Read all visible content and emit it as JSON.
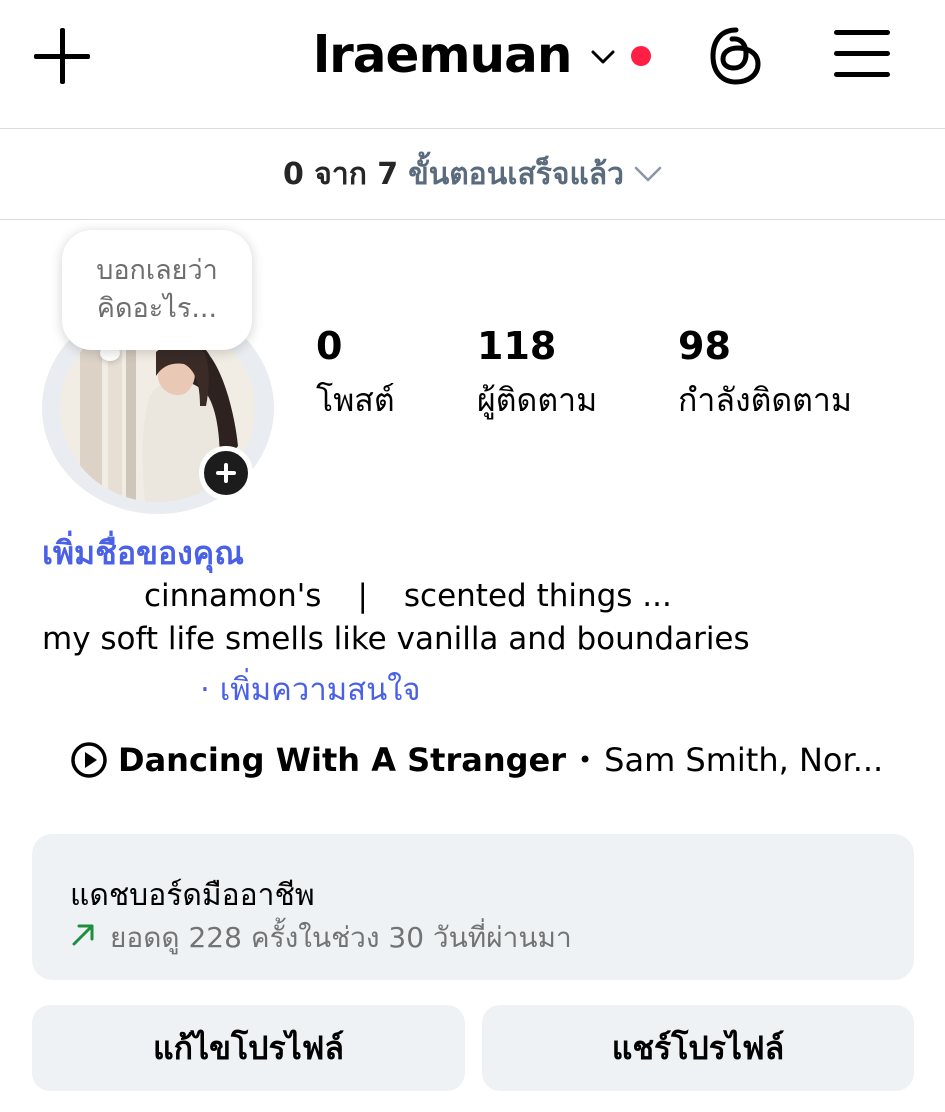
{
  "header": {
    "username": "lraemuan",
    "notification_color": "#ff1f45"
  },
  "steps": {
    "count": "0 จาก 7",
    "label": "ขั้นตอนเสร็จแล้ว"
  },
  "note": {
    "line1": "บอกเลยว่า",
    "line2": "คิดอะไร..."
  },
  "stats": [
    {
      "value": "0",
      "label": "โพสต์"
    },
    {
      "value": "118",
      "label": "ผู้ติดตาม"
    },
    {
      "value": "98",
      "label": "กำลังติดตาม"
    }
  ],
  "profile": {
    "add_name": "เพิ่มชื่อของคุณ",
    "bio_left": "cinnamon's",
    "bio_sep": "|",
    "bio_right": "scented things ...",
    "bio_line2": "my soft life smells like vanilla and boundaries",
    "add_interest": "· เพิ่มความสนใจ",
    "accent_color": "#4a60e6"
  },
  "music": {
    "song": "Dancing With A Stranger",
    "separator": "•",
    "artist": "Sam Smith, Nor..."
  },
  "dashboard": {
    "title": "แดชบอร์ดมืออาชีพ",
    "subtitle": "ยอดดู 228 ครั้งในช่วง 30 วันที่ผ่านมา",
    "trend_color": "#1e8e3e"
  },
  "buttons": {
    "edit": "แก้ไขโปรไฟล์",
    "share": "แชร์โปรไฟล์"
  }
}
